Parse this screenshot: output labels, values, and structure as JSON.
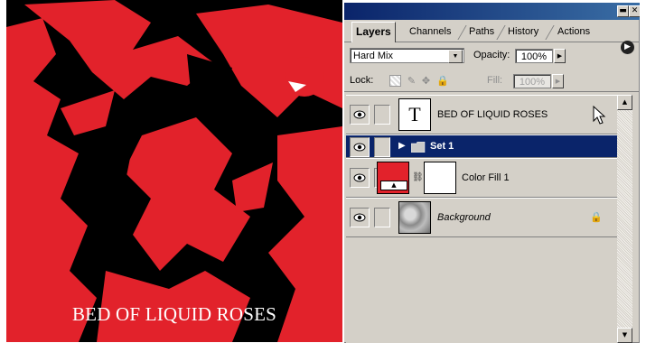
{
  "canvas": {
    "caption": "BED OF LIQUID ROSES",
    "colors": {
      "background": "#000000",
      "fill": "#e2222b",
      "text": "#ffffff"
    }
  },
  "panel": {
    "title_buttons": [
      "▬",
      "✕"
    ],
    "tabs": [
      {
        "label": "Layers",
        "active": true
      },
      {
        "label": "Channels",
        "active": false
      },
      {
        "label": "Paths",
        "active": false
      },
      {
        "label": "History",
        "active": false
      },
      {
        "label": "Actions",
        "active": false
      }
    ],
    "menu_icon": "▶",
    "blend_mode": "Hard Mix",
    "opacity_label": "Opacity:",
    "opacity_value": "100%",
    "lock_label": "Lock:",
    "fill_label": "Fill:",
    "fill_value": "100%",
    "icons": {
      "lock_transparent": "transparency-lock-icon",
      "lock_image": "brush-lock-icon",
      "lock_position": "move-lock-icon",
      "lock_all": "padlock-icon"
    },
    "layers": [
      {
        "name": "BED OF LIQUID ROSES",
        "type": "text",
        "thumb": "T",
        "selected": false
      },
      {
        "name": "Set 1",
        "type": "group",
        "selected": true
      },
      {
        "name": "Color Fill 1",
        "type": "fill",
        "selected": false,
        "fill_color": "#e2222b"
      },
      {
        "name": "Background",
        "type": "background",
        "selected": false,
        "locked": true
      }
    ],
    "colors": {
      "panel": "#d4d0c8",
      "selection": "#0a246a",
      "titlebar": "#0a246a"
    }
  }
}
